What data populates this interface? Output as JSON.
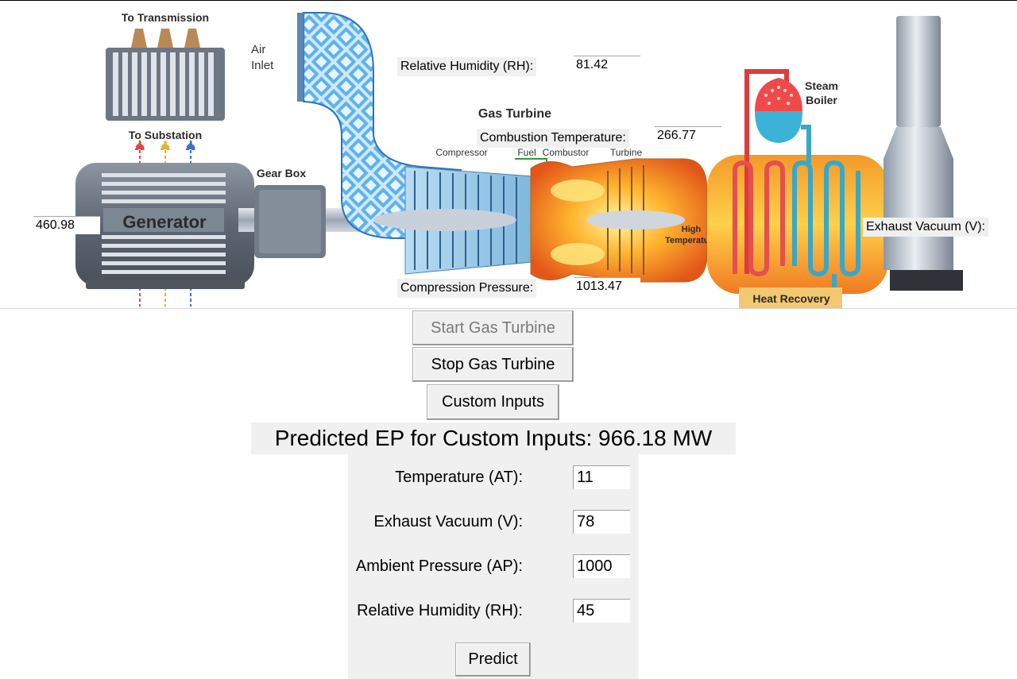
{
  "diagram": {
    "labels": {
      "to_transmission": "To Transmission",
      "to_substation": "To Substation",
      "generator": "Generator",
      "gear_box": "Gear Box",
      "air": "Air",
      "inlet": "Inlet",
      "gas_turbine": "Gas Turbine",
      "compressor": "Compressor",
      "fuel": "Fuel",
      "combustor": "Combustor",
      "turbine": "Turbine",
      "high": "High",
      "temperature": "Temperature",
      "steam": "Steam",
      "boiler": "Boiler",
      "heat_recovery": "Heat Recovery"
    }
  },
  "overlays": {
    "relative_humidity_label": "Relative Humidity (RH):",
    "relative_humidity_value": "81.42",
    "combustion_temperature_label": "Combustion Temperature:",
    "combustion_temperature_value": "266.77",
    "generator_value": "460.98",
    "exhaust_vacuum_label": "Exhaust Vacuum (V):",
    "compression_pressure_label": "Compression Pressure:",
    "compression_pressure_value": "1013.47"
  },
  "controls": {
    "start_label": "Start Gas Turbine",
    "stop_label": "Stop Gas Turbine",
    "custom_label": "Custom Inputs"
  },
  "prediction": {
    "text": "Predicted EP for Custom Inputs: 966.18 MW"
  },
  "form": {
    "fields": [
      {
        "label": "Temperature (AT):",
        "value": "11"
      },
      {
        "label": "Exhaust Vacuum (V):",
        "value": "78"
      },
      {
        "label": "Ambient Pressure (AP):",
        "value": "1000"
      },
      {
        "label": "Relative Humidity (RH):",
        "value": "45"
      }
    ],
    "predict_label": "Predict"
  },
  "colors": {
    "panel_bg": "#f0f0f0",
    "generator_body": "#6b7480",
    "hot_gas": "#f08a1e",
    "cold_pipe": "#3aa7c9",
    "hot_pipe": "#e03a3a"
  }
}
